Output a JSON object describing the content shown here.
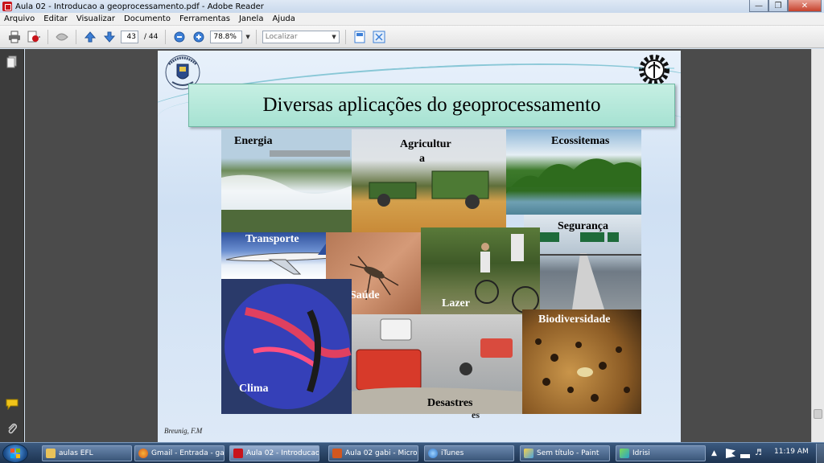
{
  "window": {
    "title": "Aula 02 - Introducao a geoprocessamento.pdf - Adobe Reader",
    "controls": [
      "minimize",
      "maximize",
      "close"
    ]
  },
  "menu": [
    "Arquivo",
    "Editar",
    "Visualizar",
    "Documento",
    "Ferramentas",
    "Janela",
    "Ajuda"
  ],
  "toolbar": {
    "current_page": "43",
    "total_pages": "/ 44",
    "zoom": "78.8%",
    "find_placeholder": "Localizar",
    "icons": [
      "print-icon",
      "create-pdf-icon",
      "share-icon",
      "prev-page-icon",
      "next-page-icon",
      "zoom-out-icon",
      "zoom-in-icon",
      "fit-page-icon",
      "fullscreen-icon"
    ]
  },
  "nav_pane": {
    "icons": [
      "pages-icon",
      "comments-icon",
      "attachments-icon"
    ]
  },
  "slide": {
    "title": "Diversas aplicações do geoprocessamento",
    "credit": "Breunig, F.M",
    "stray_text": "es",
    "tiles": [
      {
        "label": "Energia",
        "color": "#000000"
      },
      {
        "label": "Agricultur",
        "label2": "a",
        "color": "#000000"
      },
      {
        "label": "Ecossitemas",
        "color": "#000000"
      },
      {
        "label": "Segurança",
        "color": "#000000"
      },
      {
        "label": "Transporte",
        "color": "#ffffff"
      },
      {
        "label": "Saúde",
        "color": "#ffffff"
      },
      {
        "label": "Lazer",
        "color": "#ffffff"
      },
      {
        "label": "Clima",
        "color": "#ffffff"
      },
      {
        "label": "Desastres",
        "color": "#000000"
      },
      {
        "label": "Biodiversidade",
        "color": "#ffffff"
      }
    ]
  },
  "taskbar": {
    "items": [
      {
        "label": "aulas EFL",
        "icon": "folder-icon"
      },
      {
        "label": "Gmail - Entrada - ga...",
        "icon": "firefox-icon"
      },
      {
        "label": "Aula 02 - Introducao...",
        "icon": "adobe-reader-icon"
      },
      {
        "label": "Aula 02 gabi - Micro...",
        "icon": "powerpoint-icon"
      },
      {
        "label": "iTunes",
        "icon": "itunes-icon"
      },
      {
        "label": "Sem título - Paint",
        "icon": "paint-icon"
      },
      {
        "label": "Idrisi",
        "icon": "idrisi-icon"
      }
    ],
    "clock": "11:19 AM"
  }
}
